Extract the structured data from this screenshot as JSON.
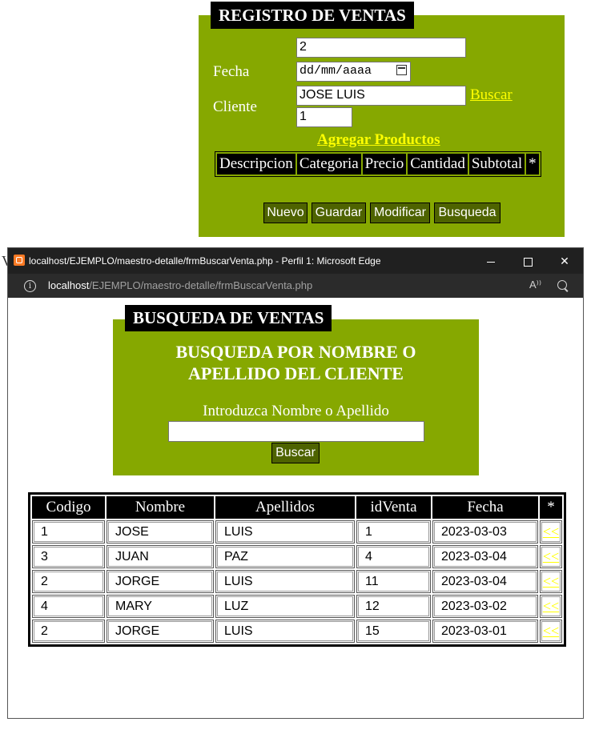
{
  "registro": {
    "title": "REGISTRO DE VENTAS",
    "venta_id": "2",
    "fecha_label": "Fecha",
    "fecha_placeholder": "dd/mm/aaaa",
    "cliente_label": "Cliente",
    "cliente_value": "JOSE LUIS",
    "buscar_link": "Buscar",
    "cantidad_value": "1",
    "agregar_link": "Agregar Productos",
    "detalle_columns": [
      "Descripcion",
      "Categoria",
      "Precio",
      "Cantidad",
      "Subtotal",
      "*"
    ],
    "buttons": {
      "nuevo": "Nuevo",
      "guardar": "Guardar",
      "modificar": "Modificar",
      "busqueda": "Busqueda"
    },
    "stray_char": "V"
  },
  "browser": {
    "window_title": "localhost/EJEMPLO/maestro-detalle/frmBuscarVenta.php - Perfil 1: Microsoft Edge",
    "url_host": "localhost",
    "url_path": "/EJEMPLO/maestro-detalle/frmBuscarVenta.php",
    "icons": [
      "xampp-icon",
      "minimize-icon",
      "maximize-icon",
      "close-icon",
      "info-icon",
      "read-aloud-icon",
      "zoom-icon"
    ],
    "close_glyph": "✕",
    "info_glyph": "i",
    "read_aloud_glyph": "A⁾⁾"
  },
  "busqueda": {
    "title": "BUSQUEDA DE VENTAS",
    "heading_line1": "BUSQUEDA POR NOMBRE O",
    "heading_line2": "APELLIDO DEL CLIENTE",
    "input_label": "Introduzca Nombre o Apellido",
    "input_value": "",
    "buscar_button": "Buscar"
  },
  "results": {
    "columns": [
      "Codigo",
      "Nombre",
      "Apellidos",
      "idVenta",
      "Fecha",
      "*"
    ],
    "rows": [
      {
        "codigo": "1",
        "nombre": "JOSE",
        "apellidos": "LUIS",
        "idventa": "1",
        "fecha": "2023-03-03",
        "link": "<<"
      },
      {
        "codigo": "3",
        "nombre": "JUAN",
        "apellidos": "PAZ",
        "idventa": "4",
        "fecha": "2023-03-04",
        "link": "<<"
      },
      {
        "codigo": "2",
        "nombre": "JORGE",
        "apellidos": "LUIS",
        "idventa": "11",
        "fecha": "2023-03-04",
        "link": "<<"
      },
      {
        "codigo": "4",
        "nombre": "MARY",
        "apellidos": "LUZ",
        "idventa": "12",
        "fecha": "2023-03-02",
        "link": "<<"
      },
      {
        "codigo": "2",
        "nombre": "JORGE",
        "apellidos": "LUIS",
        "idventa": "15",
        "fecha": "2023-03-01",
        "link": "<<"
      }
    ]
  },
  "colors": {
    "panel_green": "#86a800",
    "button_green": "#4e6300",
    "link_yellow": "#ffff00",
    "titlebar": "#202020"
  }
}
